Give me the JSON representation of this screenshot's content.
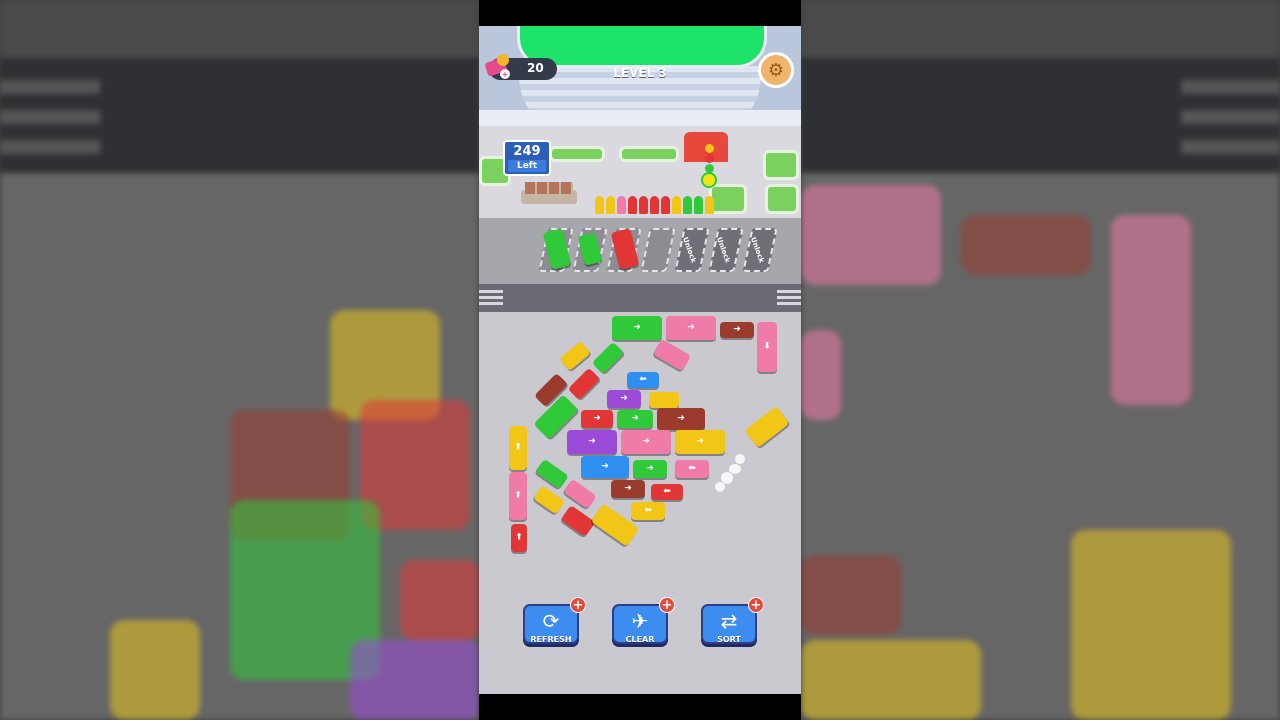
{
  "header": {
    "coins": "20",
    "level": "LEVEL 3",
    "settings_icon": "gear-icon"
  },
  "passengers": {
    "count": "249",
    "label": "Left"
  },
  "parking": {
    "locked_slot_label": "Unlock"
  },
  "boosters": [
    {
      "label": "REFRESH",
      "icon": "refresh-icon"
    },
    {
      "label": "CLEAR",
      "icon": "clear-icon"
    },
    {
      "label": "SORT",
      "icon": "sort-icon"
    }
  ],
  "colors": {
    "green": "#2fc93a",
    "pink": "#f07aa8",
    "red": "#e23636",
    "yellow": "#f2c616",
    "blue": "#2f8ff0",
    "purple": "#9b4bd8",
    "brown": "#9a3b2d"
  }
}
